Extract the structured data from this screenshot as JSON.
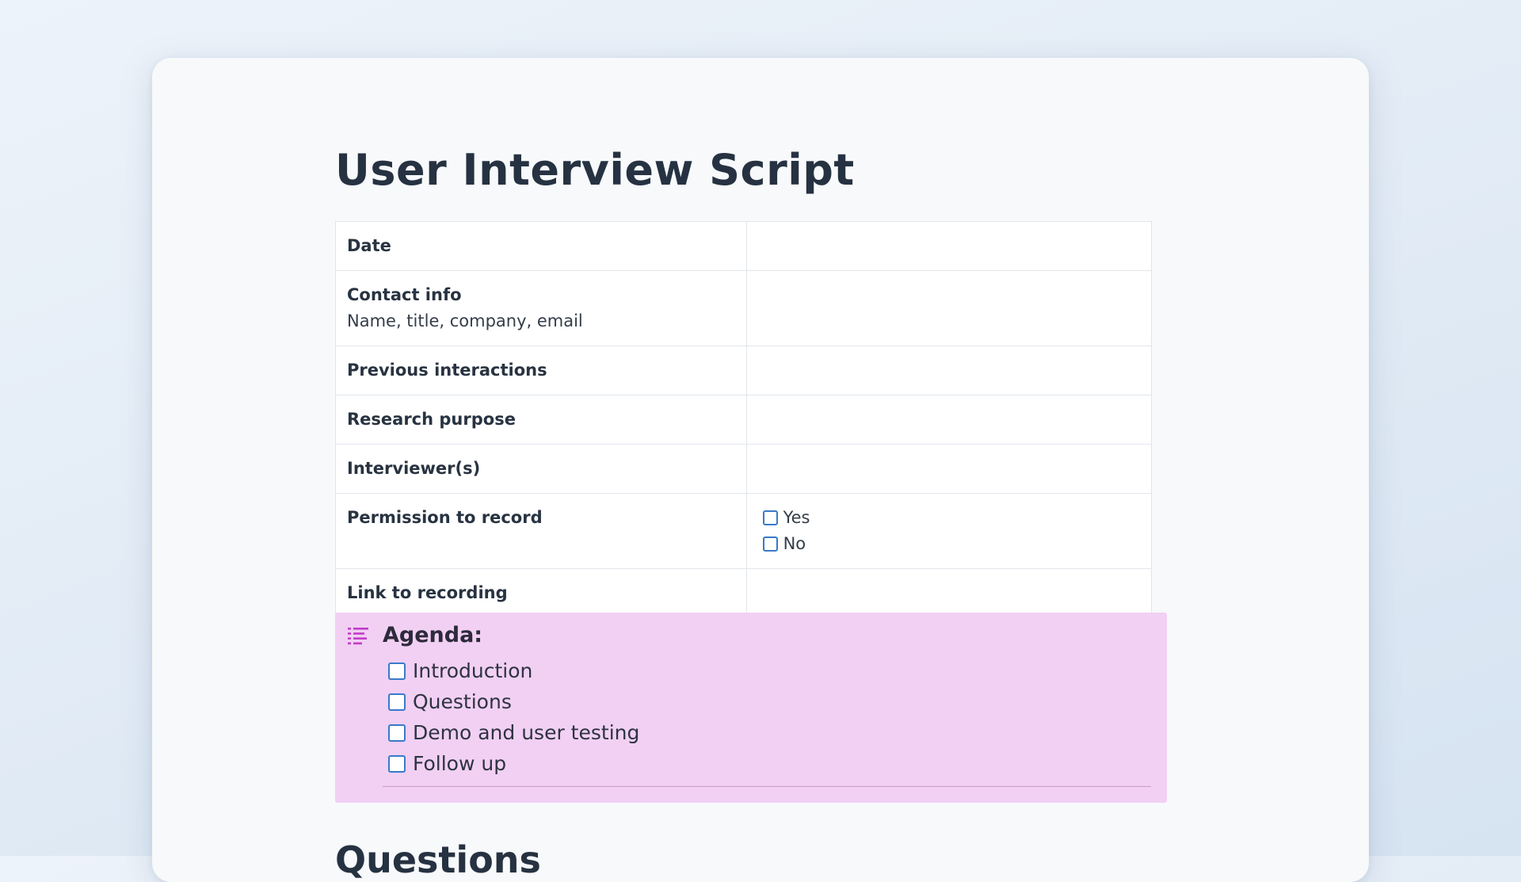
{
  "document": {
    "title": "User Interview Script",
    "properties": [
      {
        "label": "Date",
        "sublabel": "",
        "value": ""
      },
      {
        "label": "Contact info",
        "sublabel": "Name, title, company, email",
        "value": ""
      },
      {
        "label": "Previous interactions",
        "sublabel": "",
        "value": ""
      },
      {
        "label": "Research purpose",
        "sublabel": "",
        "value": ""
      },
      {
        "label": "Interviewer(s)",
        "sublabel": "",
        "value": ""
      },
      {
        "label": "Permission to record",
        "sublabel": "",
        "options": [
          "Yes",
          "No"
        ]
      },
      {
        "label": "Link to recording",
        "sublabel": "",
        "value": ""
      }
    ],
    "agenda": {
      "icon": "list-icon",
      "accent_color": "#c23cc8",
      "background_color": "#f1d0f4",
      "title": "Agenda:",
      "items": [
        "Introduction",
        "Questions",
        "Demo and user testing",
        "Follow up"
      ]
    },
    "next_section_heading": "Questions"
  }
}
